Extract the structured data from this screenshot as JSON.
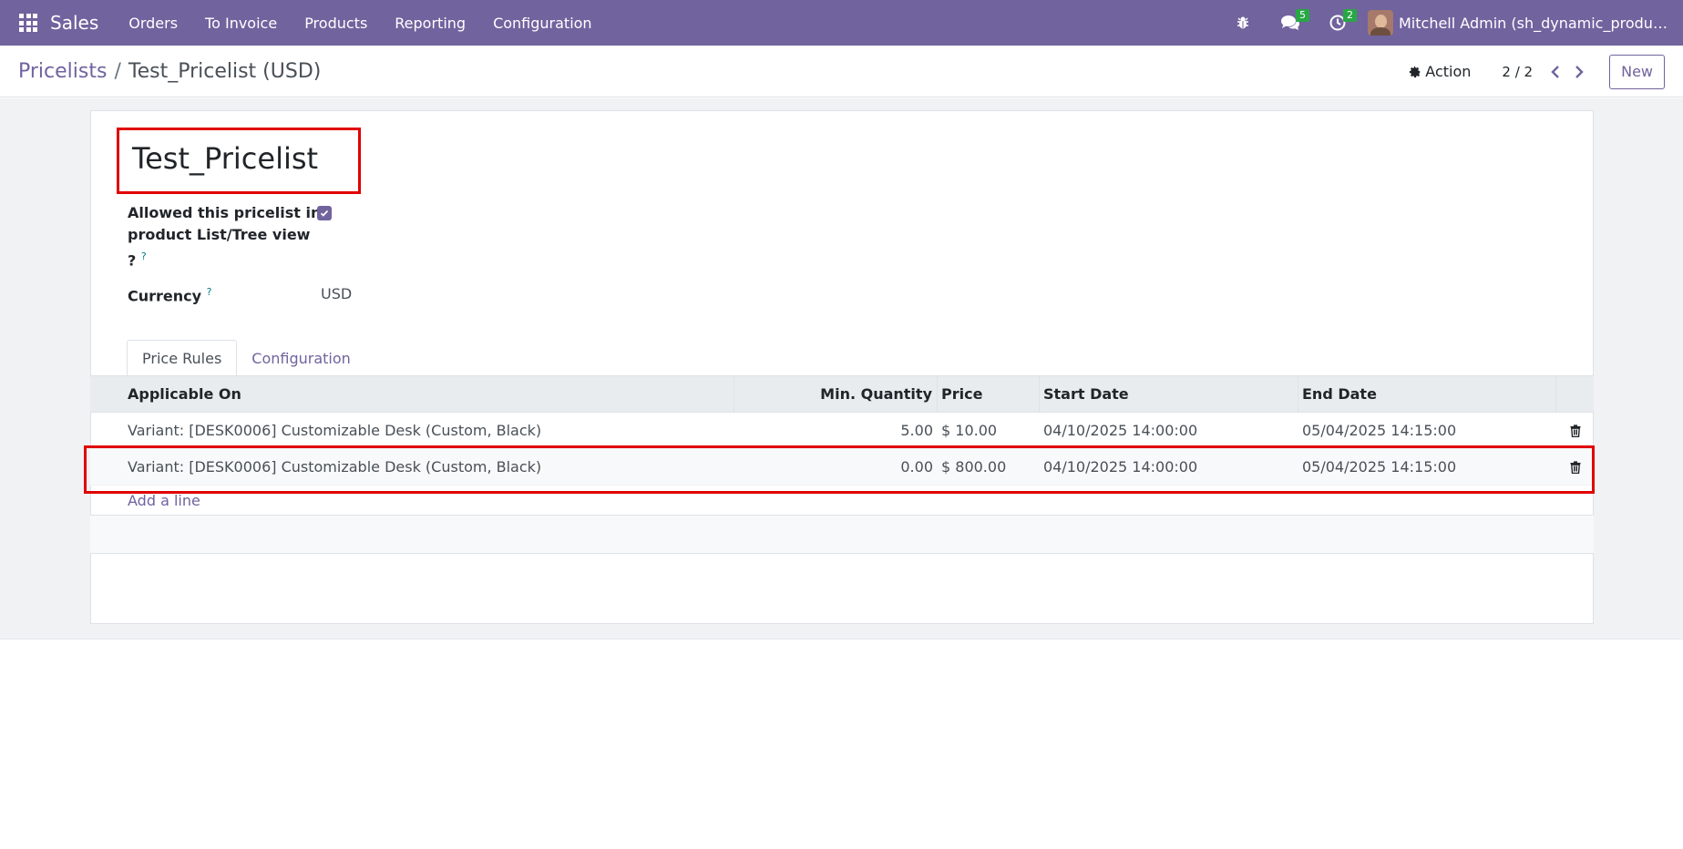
{
  "navbar": {
    "brand": "Sales",
    "menu": [
      "Orders",
      "To Invoice",
      "Products",
      "Reporting",
      "Configuration"
    ],
    "messages_badge": "5",
    "activities_badge": "2",
    "user": "Mitchell Admin (sh_dynamic_product_..."
  },
  "breadcrumb": {
    "parent": "Pricelists",
    "current": "Test_Pricelist (USD)"
  },
  "controls": {
    "action": "Action",
    "pager": "2 / 2",
    "new": "New"
  },
  "form": {
    "title": "Test_Pricelist",
    "allowed_label_line1": "Allowed this pricelist in",
    "allowed_label_line2": "product List/Tree view",
    "allowed_label_line3": "?",
    "allowed_checked": true,
    "currency_label": "Currency",
    "currency_value": "USD",
    "help_mark": "?"
  },
  "tabs": [
    "Price Rules",
    "Configuration"
  ],
  "table": {
    "headers": [
      "Applicable On",
      "Min. Quantity",
      "Price",
      "Start Date",
      "End Date"
    ],
    "rows": [
      {
        "applicable_on": "Variant: [DESK0006] Customizable Desk (Custom, Black)",
        "min_qty": "5.00",
        "price": "$ 10.00",
        "start_date": "04/10/2025 14:00:00",
        "end_date": "05/04/2025 14:15:00"
      },
      {
        "applicable_on": "Variant: [DESK0006] Customizable Desk (Custom, Black)",
        "min_qty": "0.00",
        "price": "$ 800.00",
        "start_date": "04/10/2025 14:00:00",
        "end_date": "05/04/2025 14:15:00"
      }
    ],
    "add_line": "Add a line"
  },
  "colors": {
    "brand": "#71639e",
    "highlight": "#e00000",
    "badge": "#28a745"
  }
}
